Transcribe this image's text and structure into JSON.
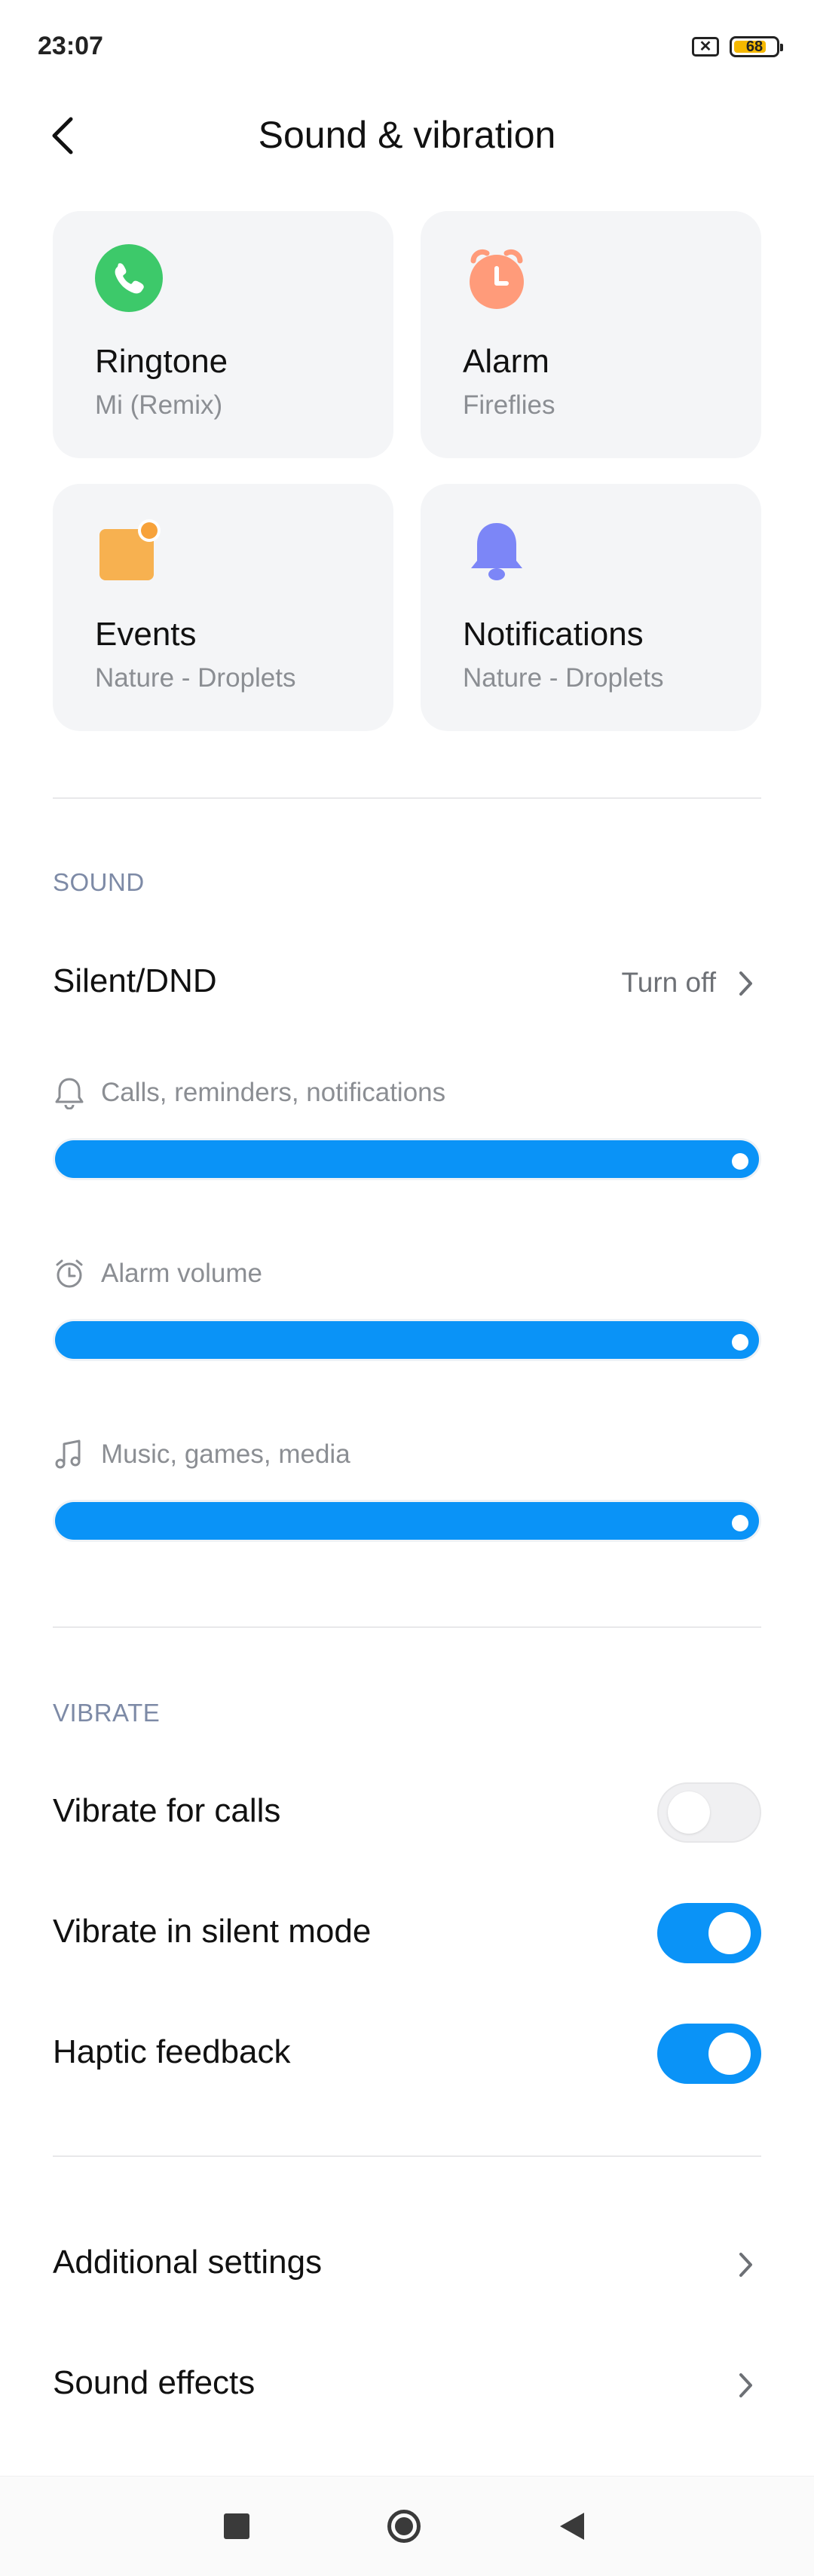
{
  "status_bar": {
    "time": "23:07",
    "battery": "68",
    "sim_icon": "sim-x-icon"
  },
  "header": {
    "title": "Sound & vibration",
    "back_icon": "back-arrow-icon"
  },
  "cards": [
    {
      "title": "Ringtone",
      "subtitle": "Mi (Remix)",
      "icon": "phone-icon",
      "color": "#3dc96a"
    },
    {
      "title": "Alarm",
      "subtitle": "Fireflies",
      "icon": "alarm-clock-icon",
      "color": "#ff9b7a"
    },
    {
      "title": "Events",
      "subtitle": "Nature - Droplets",
      "icon": "events-icon",
      "color": "#f7b150"
    },
    {
      "title": "Notifications",
      "subtitle": "Nature - Droplets",
      "icon": "bell-icon",
      "color": "#7c86f7"
    }
  ],
  "sound": {
    "section_label": "SOUND",
    "silent_dnd": {
      "label": "Silent/DND",
      "value": "Turn off"
    },
    "volumes": [
      {
        "label": "Calls, reminders, notifications",
        "icon": "bell-outline-icon",
        "level": 1.0
      },
      {
        "label": "Alarm volume",
        "icon": "alarm-outline-icon",
        "level": 1.0
      },
      {
        "label": "Music, games, media",
        "icon": "music-note-icon",
        "level": 1.0
      }
    ]
  },
  "vibrate": {
    "section_label": "VIBRATE",
    "items": [
      {
        "label": "Vibrate for calls",
        "enabled": false
      },
      {
        "label": "Vibrate in silent mode",
        "enabled": true
      },
      {
        "label": "Haptic feedback",
        "enabled": true
      }
    ]
  },
  "more": [
    {
      "label": "Additional settings"
    },
    {
      "label": "Sound effects"
    }
  ],
  "colors": {
    "accent": "#0a93f7",
    "card_bg": "#f4f5f7",
    "section_label": "#7d8aa6"
  }
}
